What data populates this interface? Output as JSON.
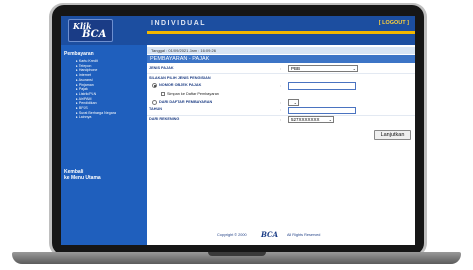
{
  "header": {
    "logo_top": "Klik",
    "logo_bottom": "BCA",
    "title": "INDIVIDUAL",
    "logout": "[ LOGOUT ]"
  },
  "sidebar": {
    "heading": "Pembayaran",
    "items": [
      "Kartu Kredit",
      "Telepon",
      "Handphone",
      "Internet",
      "Asuransi",
      "Pinjaman",
      "Pajak",
      "Listrik/PLN",
      "Air/PAM",
      "Pendidikan",
      "BPJS",
      "Surat Berharga Negara",
      "Lainnya"
    ],
    "back_line1": "Kembali",
    "back_line2": "ke Menu Utama"
  },
  "main": {
    "date_label": "Tanggal : 01/09/2021 Jam : 16:09:26",
    "page_title": "PEMBAYARAN - PAJAK",
    "jenis_pajak_label": "JENIS PAJAK",
    "jenis_pajak_value": "PBB",
    "pilih_label": "SILAKAN PILIH JENIS PENGISIAN",
    "opt_nomor": "NOMOR OBJEK PAJAK",
    "opt_simpan": "Simpan ke Daftar Pembayaran",
    "opt_daftar": "DARI DAFTAR PEMBAYARAN",
    "tahun_label": "TAHUN",
    "rekening_label": "DARI REKENING",
    "rekening_value": "527XXXXXXX",
    "submit_label": "Lanjutkan",
    "colon": ":"
  },
  "footer": {
    "copyright": "Copyright © 2000",
    "brand": "BCA",
    "rights": "All Rights Reserved"
  }
}
